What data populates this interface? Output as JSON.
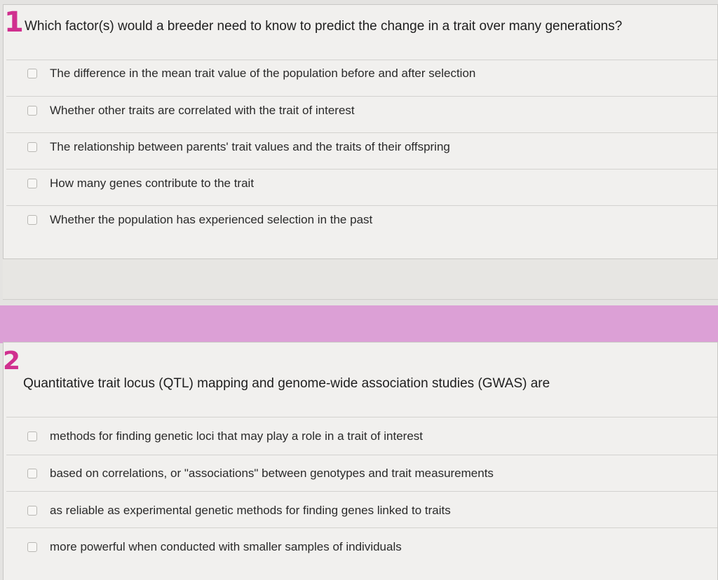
{
  "question1": {
    "marker": "1",
    "text": "Which factor(s) would a breeder need to know to predict the change in a trait over many generations?",
    "options": [
      "The difference in the mean trait value of the population before and after selection",
      "Whether other traits are correlated with the trait of interest",
      "The relationship between parents' trait values and the traits of their offspring",
      "How many genes contribute to the trait",
      "Whether the population has experienced selection in the past"
    ]
  },
  "question2": {
    "marker": "2",
    "text": "Quantitative trait locus (QTL) mapping and genome-wide association studies (GWAS) are",
    "options": [
      "methods for finding genetic loci that may play a role in a trait of interest",
      "based on correlations, or \"associations\" between genotypes and trait measurements",
      "as reliable as experimental genetic methods for finding genes linked to traits",
      "more powerful when conducted with smaller samples of individuals"
    ]
  },
  "colors": {
    "annotation_marker": "#d0308f",
    "highlight_band": "#dca0d6",
    "panel_background": "#f1f0ee"
  }
}
